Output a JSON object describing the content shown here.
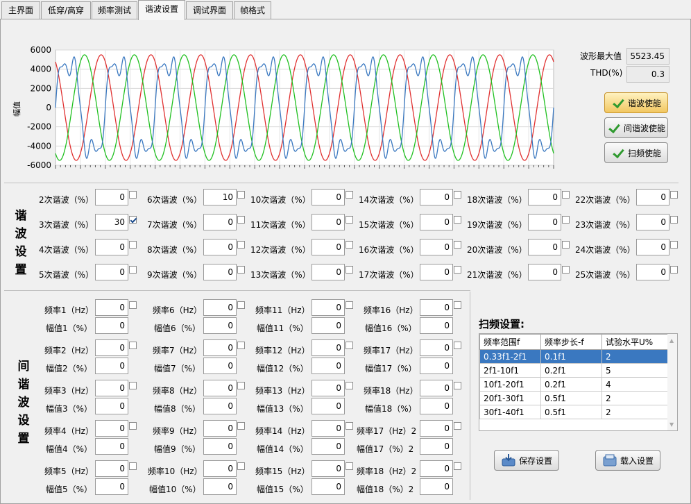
{
  "tabs": [
    {
      "label": "主界面",
      "active": false
    },
    {
      "label": "低穿/高穿",
      "active": false
    },
    {
      "label": "频率测试",
      "active": false
    },
    {
      "label": "谐波设置",
      "active": true
    },
    {
      "label": "调试界面",
      "active": false
    },
    {
      "label": "帧格式",
      "active": false
    }
  ],
  "info": {
    "wave_max_label": "波形最大值",
    "wave_max_value": "5523.45",
    "thd_label": "THD(%)",
    "thd_value": "0.3"
  },
  "buttons": {
    "harmonic_enable": "谐波使能",
    "interharmonic_enable": "间谐波使能",
    "sweep_enable": "扫频使能",
    "save": "保存设置",
    "load": "载入设置"
  },
  "section_titles": {
    "harmonic": "谐波设置",
    "interharmonic": "间谐波设置",
    "sweep": "扫频设置:"
  },
  "harmonics": [
    {
      "label": "2次谐波（%）",
      "value": "0",
      "checked": false
    },
    {
      "label": "3次谐波（%）",
      "value": "30",
      "checked": true
    },
    {
      "label": "4次谐波（%）",
      "value": "0",
      "checked": false
    },
    {
      "label": "5次谐波（%）",
      "value": "0",
      "checked": false
    },
    {
      "label": "6次谐波（%）",
      "value": "10",
      "checked": false
    },
    {
      "label": "7次谐波（%）",
      "value": "0",
      "checked": false
    },
    {
      "label": "8次谐波（%）",
      "value": "0",
      "checked": false
    },
    {
      "label": "9次谐波（%）",
      "value": "0",
      "checked": false
    },
    {
      "label": "10次谐波（%）",
      "value": "0",
      "checked": false
    },
    {
      "label": "11次谐波（%）",
      "value": "0",
      "checked": false
    },
    {
      "label": "12次谐波（%）",
      "value": "0",
      "checked": false
    },
    {
      "label": "13次谐波（%）",
      "value": "0",
      "checked": false
    },
    {
      "label": "14次谐波（%）",
      "value": "0",
      "checked": false
    },
    {
      "label": "15次谐波（%）",
      "value": "0",
      "checked": false
    },
    {
      "label": "16次谐波（%）",
      "value": "0",
      "checked": false
    },
    {
      "label": "17次谐波（%）",
      "value": "0",
      "checked": false
    },
    {
      "label": "18次谐波（%）",
      "value": "0",
      "checked": false
    },
    {
      "label": "19次谐波（%）",
      "value": "0",
      "checked": false
    },
    {
      "label": "20次谐波（%）",
      "value": "0",
      "checked": false
    },
    {
      "label": "21次谐波（%）",
      "value": "0",
      "checked": false
    },
    {
      "label": "22次谐波（%）",
      "value": "0",
      "checked": false
    },
    {
      "label": "23次谐波（%）",
      "value": "0",
      "checked": false
    },
    {
      "label": "24次谐波（%）",
      "value": "0",
      "checked": false
    },
    {
      "label": "25次谐波（%）",
      "value": "0",
      "checked": false
    }
  ],
  "interharmonics": [
    {
      "freq_label": "频率1（Hz）",
      "freq_value": "0",
      "amp_label": "幅值1（%）",
      "amp_value": "0"
    },
    {
      "freq_label": "频率2（Hz）",
      "freq_value": "0",
      "amp_label": "幅值2（%）",
      "amp_value": "0"
    },
    {
      "freq_label": "频率3（Hz）",
      "freq_value": "0",
      "amp_label": "幅值3（%）",
      "amp_value": "0"
    },
    {
      "freq_label": "频率4（Hz）",
      "freq_value": "0",
      "amp_label": "幅值4（%）",
      "amp_value": "0"
    },
    {
      "freq_label": "频率5（Hz）",
      "freq_value": "0",
      "amp_label": "幅值5（%）",
      "amp_value": "0"
    },
    {
      "freq_label": "频率6（Hz）",
      "freq_value": "0",
      "amp_label": "幅值6（%）",
      "amp_value": "0"
    },
    {
      "freq_label": "频率7（Hz）",
      "freq_value": "0",
      "amp_label": "幅值7（%）",
      "amp_value": "0"
    },
    {
      "freq_label": "频率8（Hz）",
      "freq_value": "0",
      "amp_label": "幅值8（%）",
      "amp_value": "0"
    },
    {
      "freq_label": "频率9（Hz）",
      "freq_value": "0",
      "amp_label": "幅值9（%）",
      "amp_value": "0"
    },
    {
      "freq_label": "频率10（Hz）",
      "freq_value": "0",
      "amp_label": "幅值10（%）",
      "amp_value": "0"
    },
    {
      "freq_label": "频率11（Hz）",
      "freq_value": "0",
      "amp_label": "幅值11（%）",
      "amp_value": "0"
    },
    {
      "freq_label": "频率12（Hz）",
      "freq_value": "0",
      "amp_label": "幅值12（%）",
      "amp_value": "0"
    },
    {
      "freq_label": "频率13（Hz）",
      "freq_value": "0",
      "amp_label": "幅值13（%）",
      "amp_value": "0"
    },
    {
      "freq_label": "频率14（Hz）",
      "freq_value": "0",
      "amp_label": "幅值14（%）",
      "amp_value": "0"
    },
    {
      "freq_label": "频率15（Hz）",
      "freq_value": "0",
      "amp_label": "幅值15（%）",
      "amp_value": "0"
    },
    {
      "freq_label": "频率16（Hz）",
      "freq_value": "0",
      "amp_label": "幅值16（%）",
      "amp_value": "0"
    },
    {
      "freq_label": "频率17（Hz）",
      "freq_value": "0",
      "amp_label": "幅值17（%）",
      "amp_value": "0"
    },
    {
      "freq_label": "频率18（Hz）",
      "freq_value": "0",
      "amp_label": "幅值18（%）",
      "amp_value": "0"
    },
    {
      "freq_label": "频率17（Hz）2",
      "freq_value": "0",
      "amp_label": "幅值17（%）2",
      "amp_value": "0"
    },
    {
      "freq_label": "频率18（Hz）2",
      "freq_value": "0",
      "amp_label": "幅值18（%）2",
      "amp_value": "0"
    }
  ],
  "sweep_table": {
    "columns": [
      "频率范围f",
      "频率步长-f",
      "试验水平U%"
    ],
    "rows": [
      [
        "0.33f1-2f1",
        "0.1f1",
        "2"
      ],
      [
        "2f1-10f1",
        "0.2f1",
        "5"
      ],
      [
        "10f1-20f1",
        "0.2f1",
        "4"
      ],
      [
        "20f1-30f1",
        "0.5f1",
        "2"
      ],
      [
        "30f1-40f1",
        "0.5f1",
        "2"
      ]
    ],
    "selected_row": 0
  },
  "chart_data": {
    "type": "line",
    "title": "",
    "xlabel": "",
    "ylabel": "幅值",
    "ylim": [
      -6000,
      6000
    ],
    "yticks": [
      "6000",
      "4000",
      "2000",
      "0",
      "-2000",
      "-4000",
      "-6000"
    ],
    "grid": true,
    "series": [
      {
        "color": "#e03030",
        "amplitude": 5500,
        "cycles": 10,
        "phase_deg": 120
      },
      {
        "color": "#20c020",
        "amplitude": 5500,
        "cycles": 10,
        "phase_deg": 240
      },
      {
        "color": "#3a78c0",
        "amplitude": 5500,
        "cycles": 10,
        "phase_deg": 0,
        "harmonic_3_pct": 30,
        "harmonic_6_pct": 10
      }
    ]
  }
}
